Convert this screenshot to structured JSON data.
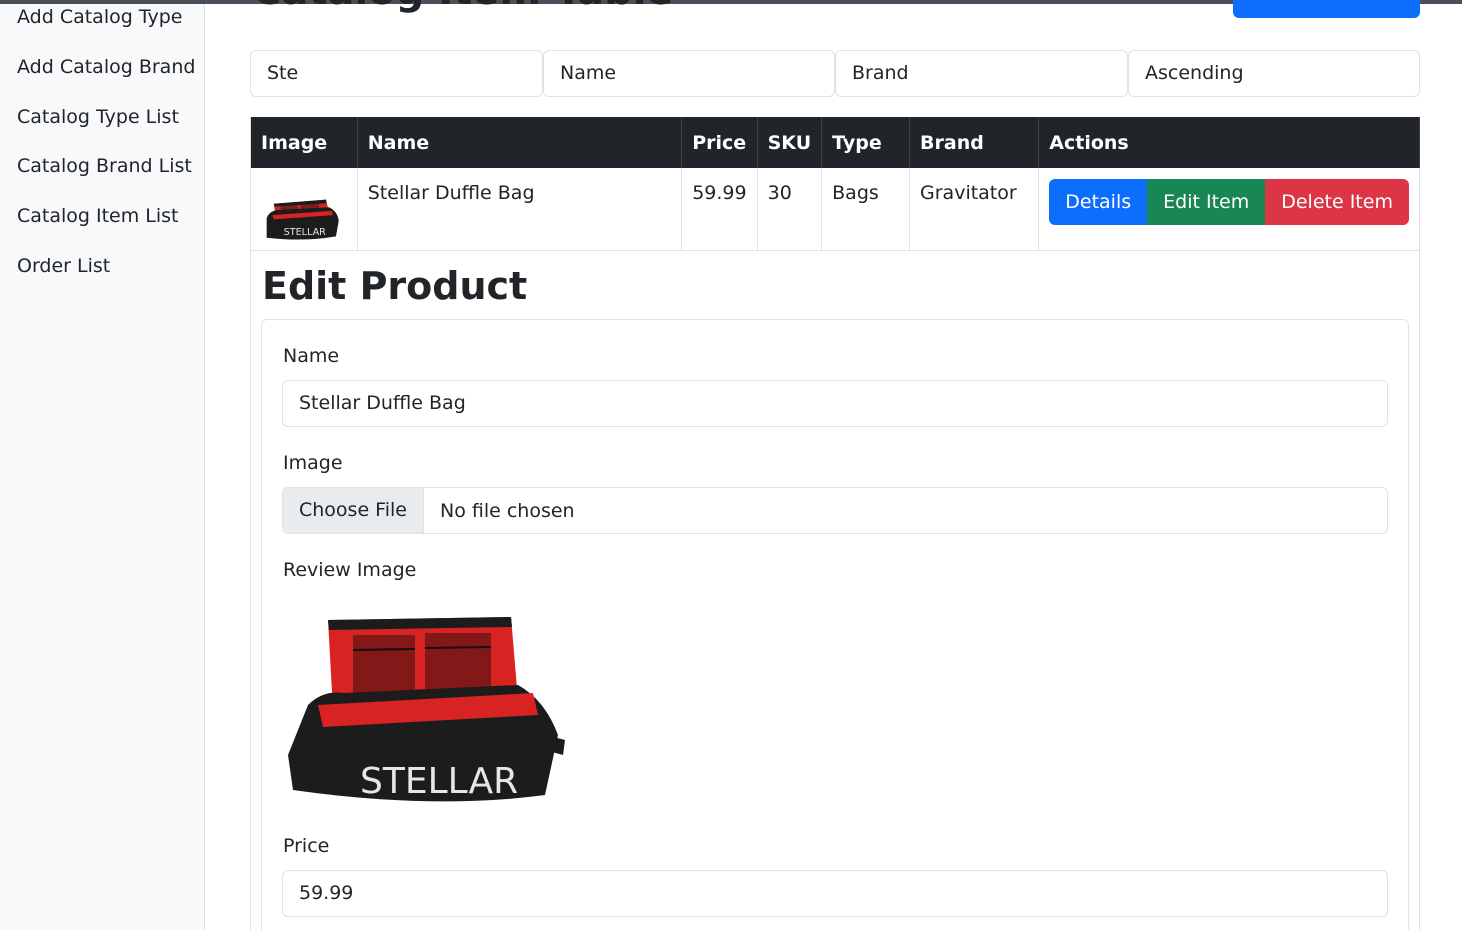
{
  "sidebar": {
    "items": [
      {
        "label": "Add Catalog Type"
      },
      {
        "label": "Add Catalog Brand"
      },
      {
        "label": "Catalog Type List"
      },
      {
        "label": "Catalog Brand List"
      },
      {
        "label": "Catalog Item List"
      },
      {
        "label": "Order List"
      }
    ]
  },
  "page": {
    "title": "Catalog Item Table"
  },
  "filters": {
    "search_value": "Ste",
    "sort_field": "Name",
    "brand": "Brand",
    "order": "Ascending"
  },
  "table": {
    "headers": [
      "Image",
      "Name",
      "Price",
      "SKU",
      "Type",
      "Brand",
      "Actions"
    ],
    "rows": [
      {
        "image_brand_text": "STELLAR",
        "name": "Stellar Duffle Bag",
        "price": "59.99",
        "sku": "30",
        "type": "Bags",
        "brand": "Gravitator",
        "actions": {
          "details": "Details",
          "edit": "Edit Item",
          "delete": "Delete Item"
        }
      }
    ]
  },
  "edit_form": {
    "title": "Edit Product",
    "name_label": "Name",
    "name_value": "Stellar Duffle Bag",
    "image_label": "Image",
    "choose_file": "Choose File",
    "file_status": "No file chosen",
    "review_label": "Review Image",
    "review_image_brand_text": "STELLAR",
    "price_label": "Price",
    "price_value": "59.99"
  },
  "colors": {
    "primary": "#0d6efd",
    "success": "#198754",
    "danger": "#dc3545",
    "dark": "#212529"
  }
}
